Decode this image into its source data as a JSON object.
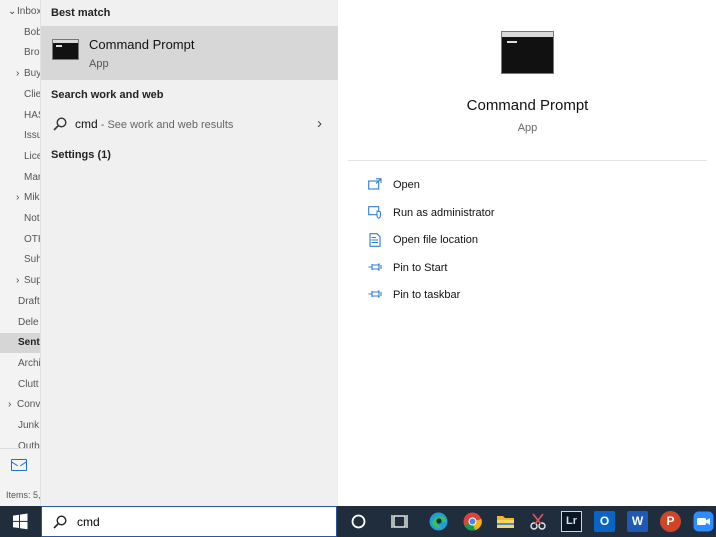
{
  "outlook": {
    "folders": [
      {
        "label": "Inbox",
        "chevron": "⌄",
        "indent": 0
      },
      {
        "label": "Bob",
        "indent": 1
      },
      {
        "label": "Bro",
        "indent": 1
      },
      {
        "label": "Buy",
        "chevron": "›",
        "indent": 1
      },
      {
        "label": "Clie",
        "indent": 1
      },
      {
        "label": "HAS",
        "indent": 1
      },
      {
        "label": "Issu",
        "indent": 1
      },
      {
        "label": "Lice",
        "indent": 1
      },
      {
        "label": "Mar",
        "indent": 1
      },
      {
        "label": "Mik",
        "chevron": "›",
        "indent": 1
      },
      {
        "label": "Not",
        "indent": 1
      },
      {
        "label": "OTH",
        "indent": 1
      },
      {
        "label": "Suh",
        "indent": 1
      },
      {
        "label": "Sup",
        "chevron": "›",
        "indent": 1
      },
      {
        "label": "Draft",
        "indent": 0
      },
      {
        "label": "Dele",
        "indent": 0
      },
      {
        "label": "Sent",
        "indent": 0,
        "selected": true
      },
      {
        "label": "Archi",
        "indent": 0
      },
      {
        "label": "Clutt",
        "indent": 0
      },
      {
        "label": "Conv",
        "chevron": "›",
        "indent": 0
      },
      {
        "label": "Junk",
        "indent": 0
      },
      {
        "label": "Outb",
        "indent": 0
      }
    ],
    "footer": "Items: 5,"
  },
  "search": {
    "best_match_header": "Best match",
    "best_match_title": "Command Prompt",
    "best_match_sub": "App",
    "web_header": "Search work and web",
    "web_query": "cmd",
    "web_hint": " - See work and web results",
    "settings_header": "Settings (1)",
    "query": "cmd"
  },
  "details": {
    "title": "Command Prompt",
    "subtitle": "App",
    "actions": [
      {
        "label": "Open",
        "icon": "open-icon"
      },
      {
        "label": "Run as administrator",
        "icon": "shield-icon"
      },
      {
        "label": "Open file location",
        "icon": "file-location-icon"
      },
      {
        "label": "Pin to Start",
        "icon": "pin-icon"
      },
      {
        "label": "Pin to taskbar",
        "icon": "pin-icon"
      }
    ]
  },
  "taskbar": {
    "icons": [
      "windows-start-icon",
      "cortana-icon",
      "task-view-icon",
      "edge-icon",
      "chrome-icon",
      "file-explorer-icon",
      "snipping-tool-icon",
      "lightroom-icon",
      "outlook-icon",
      "word-icon",
      "powerpoint-icon",
      "zoom-icon"
    ],
    "lightroom_text": "Lr",
    "outlook_text": "O",
    "word_text": "W",
    "powerpoint_text": "P"
  },
  "colors": {
    "accent": "#0078d7",
    "taskbar": "#1f2d3d",
    "selected_row": "#d7d7d7"
  }
}
